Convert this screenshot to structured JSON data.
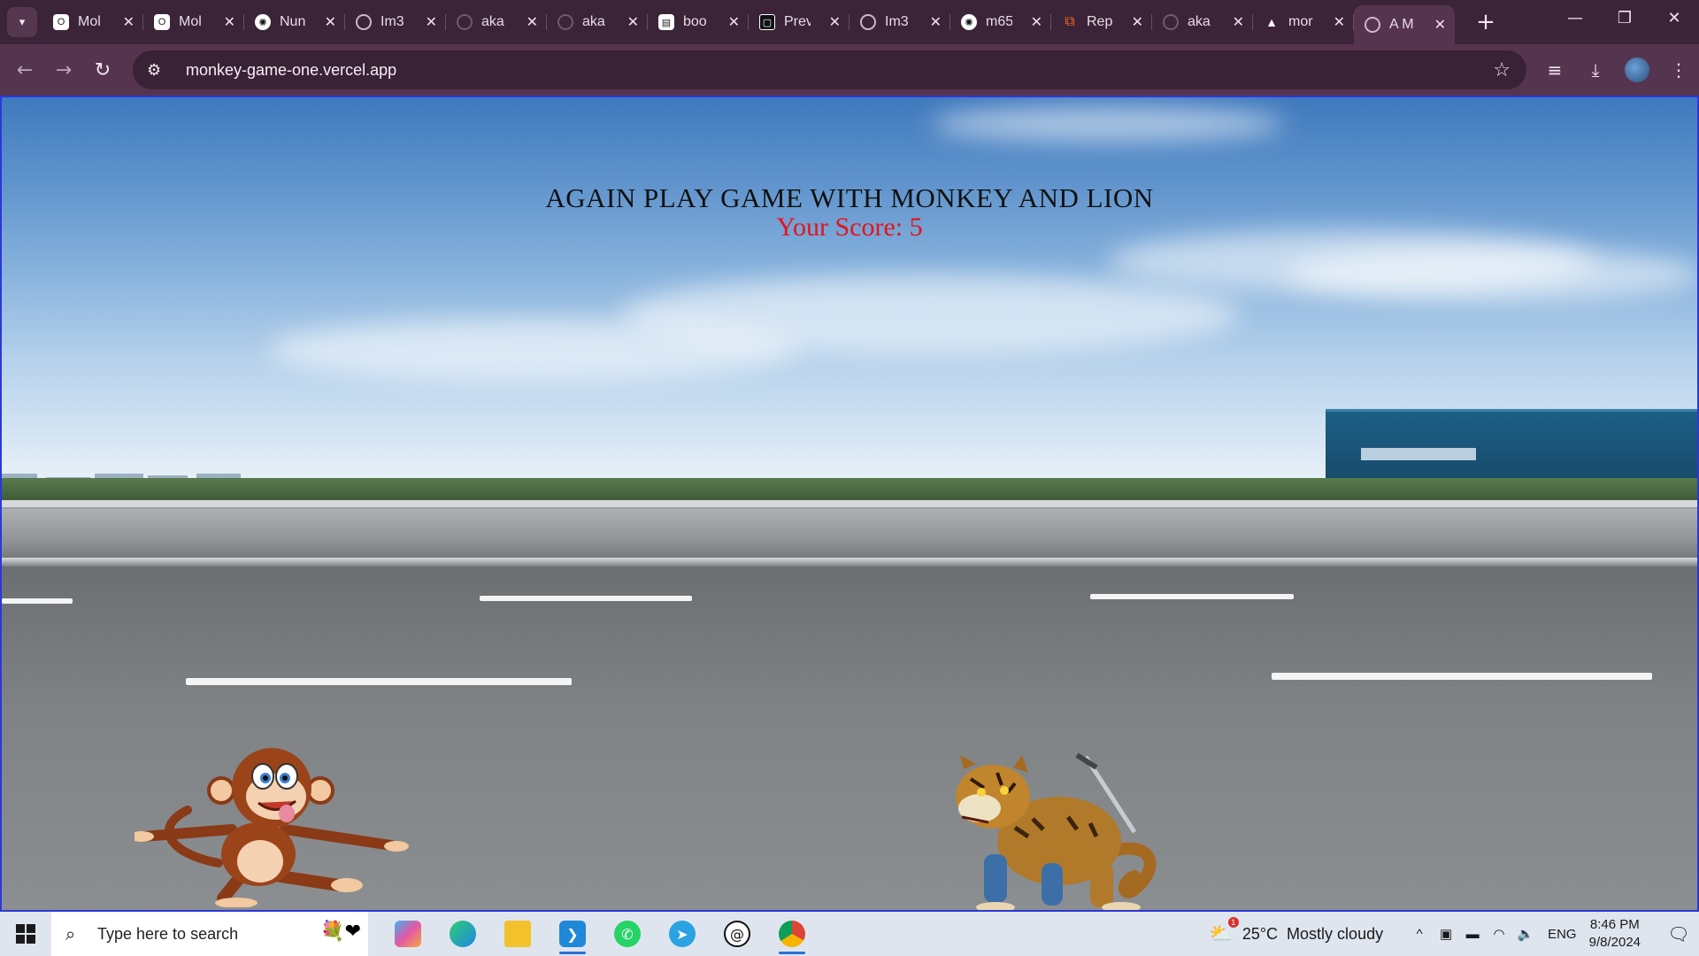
{
  "browser": {
    "tabs": [
      {
        "title": "Mol",
        "favicon": "circle-logo-icon",
        "active": false
      },
      {
        "title": "Mol",
        "favicon": "circle-logo-icon",
        "active": false
      },
      {
        "title": "Nun",
        "favicon": "chatgpt-icon",
        "active": false
      },
      {
        "title": "Im3",
        "favicon": "globe-icon",
        "active": false
      },
      {
        "title": "aka",
        "favicon": "github-icon",
        "active": false
      },
      {
        "title": "aka",
        "favicon": "github-icon",
        "active": false
      },
      {
        "title": "boo",
        "favicon": "books-icon",
        "active": false
      },
      {
        "title": "Prev",
        "favicon": "preview-icon",
        "active": false
      },
      {
        "title": "Im3",
        "favicon": "globe-icon",
        "active": false
      },
      {
        "title": "m65",
        "favicon": "chatgpt-icon",
        "active": false
      },
      {
        "title": "Rep",
        "favicon": "replit-icon",
        "active": false
      },
      {
        "title": "aka",
        "favicon": "github-icon",
        "active": false
      },
      {
        "title": "mor",
        "favicon": "vercel-icon",
        "active": false
      },
      {
        "title": "A M",
        "favicon": "globe-icon",
        "active": true
      }
    ],
    "url": "monkey-game-one.vercel.app"
  },
  "game": {
    "title": "AGAIN PLAY GAME WITH MONKEY AND LION",
    "score_label": "Your Score:",
    "score_value": "5",
    "score_color": "#e3141c"
  },
  "taskbar": {
    "search_placeholder": "Type here to search",
    "apps": [
      "copilot-icon",
      "edge-icon",
      "file-explorer-icon",
      "vscode-icon",
      "whatsapp-icon",
      "telegram-icon",
      "threads-icon",
      "chrome-icon"
    ],
    "weather_temp": "25°C",
    "weather_desc": "Mostly cloudy",
    "weather_badge": "1",
    "language": "ENG",
    "time": "8:46 PM",
    "date": "9/8/2024"
  }
}
